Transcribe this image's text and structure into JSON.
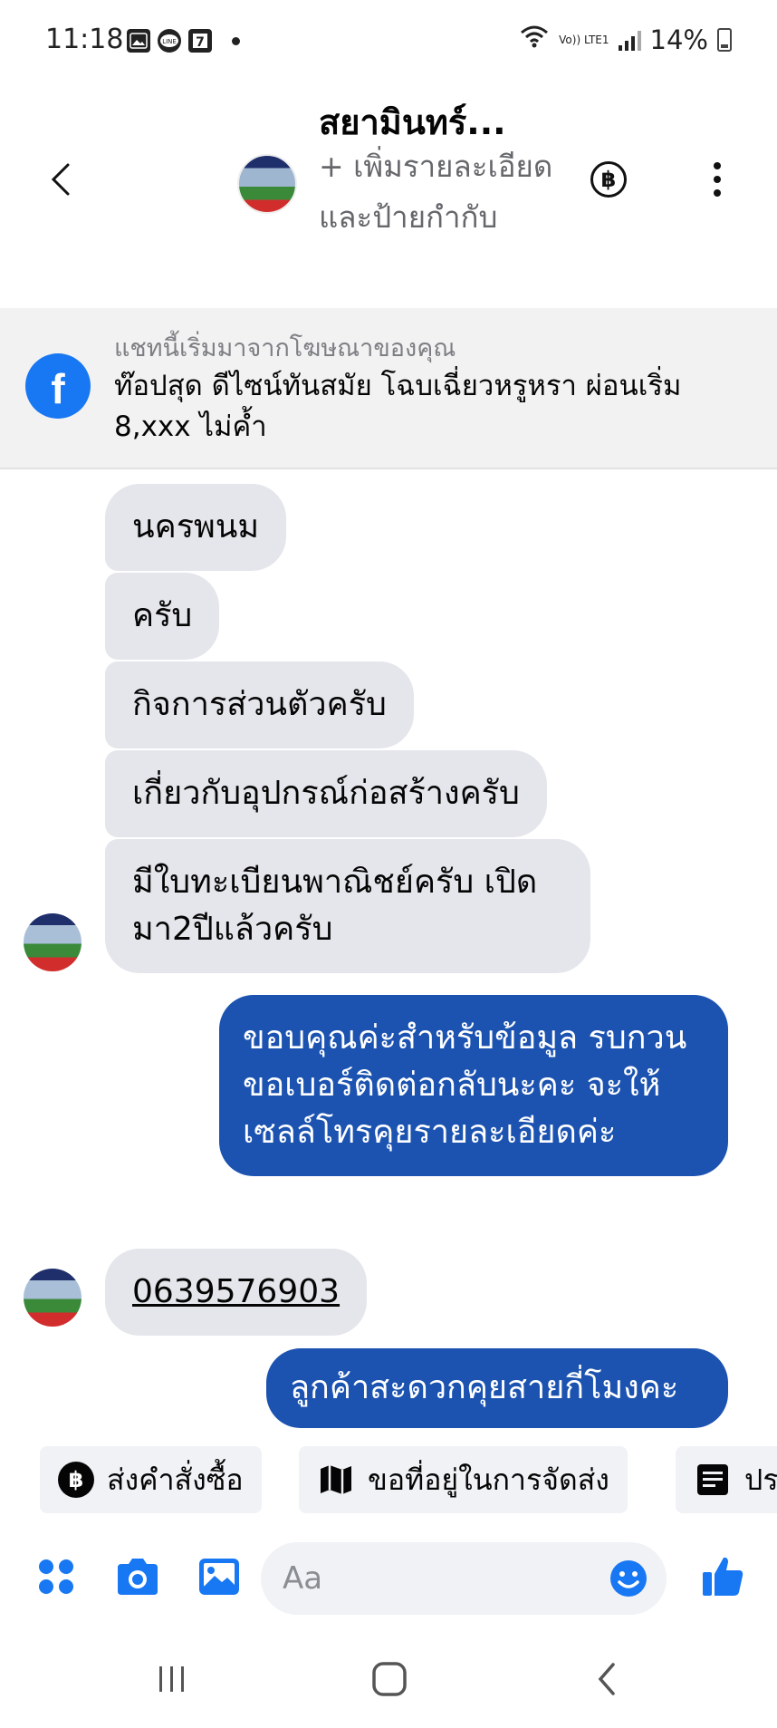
{
  "status_bar": {
    "time": "11:18",
    "battery": "14%",
    "network_label": "Vo)) LTE1",
    "notification_icons": [
      "gallery-icon",
      "line-icon",
      "seven-eleven-icon"
    ]
  },
  "header": {
    "name": "สยามินทร์...",
    "subtitle": "+ เพิ่มรายละเอียดและป้ายกำกับ",
    "payment_icon": "baht-icon"
  },
  "ad_banner": {
    "caption": "แชทนี้เริ่มมาจากโฆษณาของคุณ",
    "text": "ท๊อปสุด ดีไซน์ทันสมัย โฉบเฉี่ยวหรูหรา ผ่อนเริ่ม 8,xxx ไม่ค้ำ",
    "logo": "f"
  },
  "messages": [
    {
      "sender": "them",
      "text": "นครพนม"
    },
    {
      "sender": "them",
      "text": "ครับ"
    },
    {
      "sender": "them",
      "text": "กิจการส่วนตัวครับ"
    },
    {
      "sender": "them",
      "text": "เกี่ยวกับอุปกรณ์ก่อสร้างครับ"
    },
    {
      "sender": "them",
      "text": "มีใบทะเบียนพาณิชย์ครับ เปิดมา2ปีแล้วครับ"
    },
    {
      "sender": "me",
      "text": "ขอบคุณค่ะสำหรับข้อมูล รบกวนขอเบอร์ติดต่อกลับนะคะ จะให้เซลล์โทรคุยรายละเอียดค่ะ"
    },
    {
      "sender": "them",
      "text": "0639576903"
    },
    {
      "sender": "me",
      "text": "ลูกค้าสะดวกคุยสายกี่โมงคะ"
    }
  ],
  "quick_replies": [
    {
      "label": "ส่งคำสั่งซื้อ",
      "icon": "baht-icon"
    },
    {
      "label": "ขอที่อยู่ในการจัดส่ง",
      "icon": "map-icon"
    },
    {
      "label": "ปร",
      "icon": "form-icon"
    }
  ],
  "composer": {
    "placeholder": "Aa"
  },
  "colors": {
    "accent": "#1877f2",
    "outgoing_bubble": "#1c53b0",
    "incoming_bubble": "#e4e6eb"
  }
}
